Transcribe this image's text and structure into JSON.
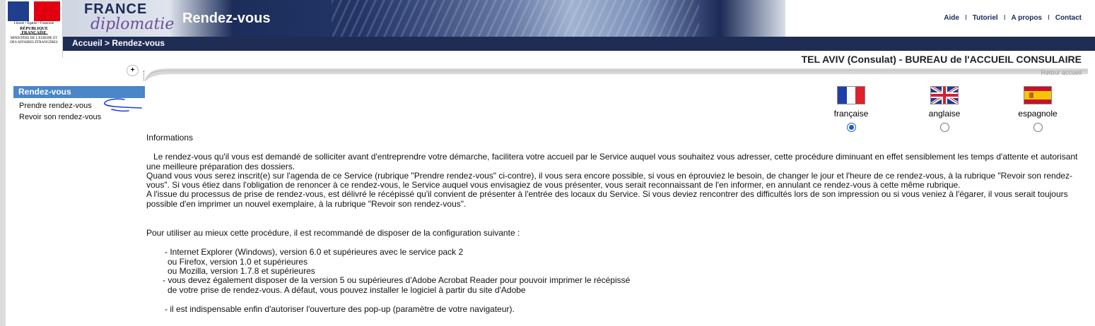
{
  "header": {
    "logo": {
      "motto": "Liberté • Égalité • Fraternité",
      "republic": "RÉPUBLIQUE FRANÇAISE",
      "ministry": "MINISTÈRE DE L'EUROPE ET DES AFFAIRES ÉTRANGÈRES"
    },
    "brand_line1": "FRANCE",
    "brand_line2": "diplomatie",
    "banner_title": "Rendez-vous",
    "links": [
      "Aide",
      "Tutoriel",
      "A propos",
      "Contact"
    ],
    "link_separator": "I"
  },
  "navbar": {
    "breadcrumb": "Accueil > Rendez-vous"
  },
  "consulate_title": "TEL AVIV (Consulat) - BUREAU de l'ACCUEIL CONSULAIRE",
  "retour_link": "Retour accueil",
  "sidebar": {
    "toggle_label": "+",
    "heading": "Rendez-vous",
    "items": [
      "Prendre rendez-vous",
      "Revoir son rendez-vous"
    ]
  },
  "languages": {
    "options": [
      {
        "label": "française",
        "flag": "fr-flag-icon",
        "selected": true
      },
      {
        "label": "anglaise",
        "flag": "uk-flag-icon",
        "selected": false
      },
      {
        "label": "espagnole",
        "flag": "es-flag-icon",
        "selected": false
      }
    ]
  },
  "content": {
    "title": "Informations",
    "para1": "Le rendez-vous qu'il vous est demandé de solliciter avant d'entreprendre votre démarche, facilitera votre accueil par le Service auquel vous souhaitez vous adresser, cette procédure diminuant en effet sensiblement les temps d'attente et autorisant une meilleure préparation des dossiers.",
    "para2": "Quand vous vous serez inscrit(e) sur l'agenda de ce Service (rubrique \"Prendre rendez-vous\" ci-contre), il vous sera encore possible, si vous en éprouviez le besoin, de changer le jour et l'heure de ce rendez-vous, à la rubrique \"Revoir son rendez-vous\". Si vous étiez dans l'obligation de renoncer à ce rendez-vous, le Service auquel vous envisagiez de vous présenter, vous serait reconnaissant de l'en informer, en annulant ce rendez-vous à cette même rubrique.",
    "para3": "A l'issue du processus de prise de rendez-vous, est délivré le récépissé qu'il convient de présenter à l'entrée des locaux du Service. Si vous deviez rencontrer des difficultés lors de son impression ou si vous veniez à l'égarer, il vous serait toujours possible d'en imprimer un nouvel exemplaire, à la rubrique \"Revoir son rendez-vous\".",
    "config_intro": "Pour utiliser au mieux cette procédure, il est recommandé de disposer de la configuration suivante :",
    "req1": "- Internet Explorer (Windows), version 6.0 et supérieures avec le service pack 2",
    "req2": "ou Firefox, version 1.0 et supérieures",
    "req3": "ou Mozilla, version 1.7.8 et supérieures",
    "req4": "- vous devez également disposer de la version 5 ou supérieures d'Adobe Acrobat Reader pour pouvoir imprimer le récépissé",
    "req5": "de votre prise de rendez-vous. A défaut, vous pouvez installer le logiciel à partir du site d'Adobe",
    "req6": "- il est indispensable enfin d'autoriser l'ouverture des pop-up (paramètre de votre navigateur)."
  },
  "colors": {
    "navy": "#1f2d55",
    "menu_blue": "#4a86c8",
    "radio_selected": "#1a5cd6"
  }
}
